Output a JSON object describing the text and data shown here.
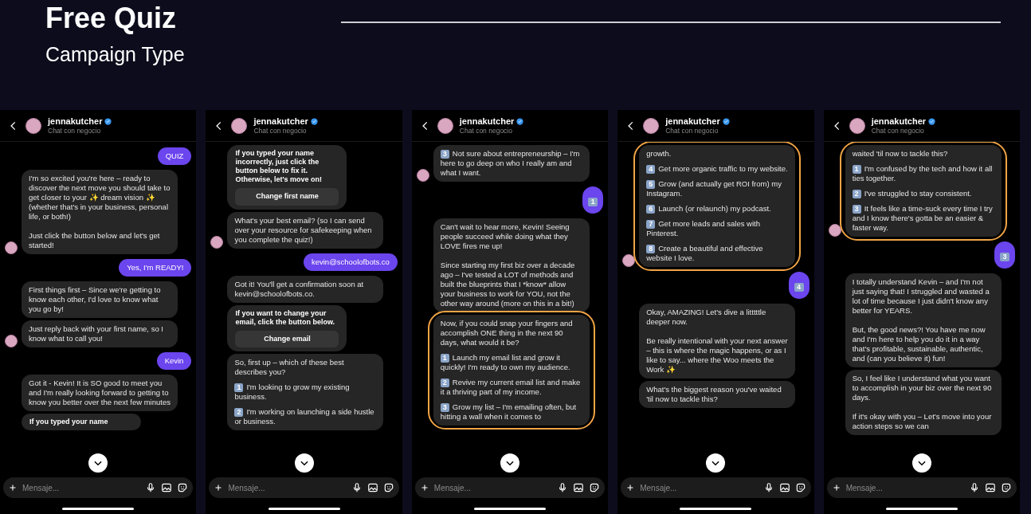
{
  "slide": {
    "title": "Free Quiz",
    "subtitle": "Campaign Type"
  },
  "phones": [
    {
      "header": {
        "name": "jennakutcher",
        "subtitle": "Chat con negocio"
      },
      "composer": {
        "placeholder": "Mensaje..."
      },
      "messages": [
        {
          "kind": "sent",
          "text": "QUIZ"
        },
        {
          "kind": "received",
          "avatar": true,
          "circled": false,
          "text": "I'm so excited you're here – ready to discover the next move you should take to get closer to your ✨ dream vision ✨ (whether that's in your business, personal life, or both!)\n\nJust click the button below and let's get started!"
        },
        {
          "kind": "sent",
          "text": "Yes, I'm READY!"
        },
        {
          "kind": "received",
          "avatar": false,
          "circled": false,
          "text": "First things first – Since we're getting to know each other, I'd love to know what you go by!"
        },
        {
          "kind": "received",
          "avatar": true,
          "circled": false,
          "text": "Just reply back with your first name, so I know what to call you!"
        },
        {
          "kind": "sent",
          "text": "Kevin"
        },
        {
          "kind": "received",
          "avatar": false,
          "circled": false,
          "text": "Got it - Kevin! It is SO good to meet you and I'm really looking forward to getting to know you better over the next few minutes"
        },
        {
          "kind": "card",
          "text": "If you typed your name"
        }
      ]
    },
    {
      "header": {
        "name": "jennakutcher",
        "subtitle": "Chat con negocio"
      },
      "composer": {
        "placeholder": "Mensaje..."
      },
      "messages": [
        {
          "kind": "card",
          "text": "If you typed your name incorrectly, just click the button below to fix it. Otherwise, let's move on!",
          "button": "Change first name"
        },
        {
          "kind": "received",
          "avatar": true,
          "circled": false,
          "text": "What's your best email? (so I can send over your resource for safekeeping when you complete the quiz!)"
        },
        {
          "kind": "sent",
          "text": "kevin@schoolofbots.co"
        },
        {
          "kind": "received",
          "avatar": false,
          "circled": false,
          "text": "Got it! You'll get a confirmation soon at kevin@schoolofbots.co."
        },
        {
          "kind": "card",
          "text": "If you want to change your email, click the button below.",
          "button": "Change email"
        },
        {
          "kind": "options",
          "avatar": false,
          "circled": false,
          "intro": "So, first up – which of these best describes you?",
          "options": [
            {
              "num": "1",
              "text": "I'm looking to grow my existing business."
            },
            {
              "num": "2",
              "text": "I'm working on launching a side hustle or business."
            }
          ]
        }
      ]
    },
    {
      "header": {
        "name": "jennakutcher",
        "subtitle": "Chat con negocio"
      },
      "composer": {
        "placeholder": "Mensaje..."
      },
      "messages": [
        {
          "kind": "options",
          "avatar": true,
          "circled": false,
          "options": [
            {
              "num": "3",
              "text": "Not sure about entrepreneurship – I'm here to go deep on who I really am and what I want."
            }
          ]
        },
        {
          "kind": "keycap",
          "num": "1"
        },
        {
          "kind": "received",
          "avatar": false,
          "circled": false,
          "text": "Can't wait to hear more, Kevin! Seeing people succeed while doing what they LOVE fires me up!\n\nSince starting my first biz over a decade ago – I've tested a LOT of methods and built the blueprints that I *know* allow your business to work for YOU, not the other way around (more on this in a bit!)"
        },
        {
          "kind": "options",
          "avatar": false,
          "circled": true,
          "intro": "Now, if you could snap your fingers and accomplish ONE thing in the next 90 days, what would it be?",
          "options": [
            {
              "num": "1",
              "text": "Launch my email list and grow it quickly! I'm ready to own my audience."
            },
            {
              "num": "2",
              "text": "Revive my current email list and make it a thriving part of my income."
            },
            {
              "num": "3",
              "text": "Grow my list – I'm emailing often, but hitting a wall when it comes to"
            }
          ]
        }
      ]
    },
    {
      "header": {
        "name": "jennakutcher",
        "subtitle": "Chat con negocio"
      },
      "composer": {
        "placeholder": "Mensaje..."
      },
      "messages": [
        {
          "kind": "options",
          "avatar": true,
          "circled": true,
          "intro": "growth.",
          "options": [
            {
              "num": "4",
              "text": "Get more organic traffic to my website."
            },
            {
              "num": "5",
              "text": "Grow (and actually get ROI from) my Instagram."
            },
            {
              "num": "6",
              "text": "Launch (or relaunch) my podcast."
            },
            {
              "num": "7",
              "text": "Get more leads and sales with Pinterest."
            },
            {
              "num": "8",
              "text": "Create a beautiful and effective website I love."
            }
          ]
        },
        {
          "kind": "keycap",
          "num": "4"
        },
        {
          "kind": "received",
          "avatar": false,
          "circled": false,
          "text": "Okay, AMAZING! Let's dive a litttttle deeper now.\n\nBe really intentional with your next answer – this is where the magic happens, or as I like to say... where the Woo meets the Work ✨"
        },
        {
          "kind": "received",
          "avatar": false,
          "circled": false,
          "text": "What's the biggest reason you've waited 'til now to tackle this?"
        }
      ]
    },
    {
      "header": {
        "name": "jennakutcher",
        "subtitle": "Chat con negocio"
      },
      "composer": {
        "placeholder": "Mensaje..."
      },
      "messages": [
        {
          "kind": "options",
          "avatar": true,
          "circled": true,
          "intro": "waited 'til now to tackle this?",
          "options": [
            {
              "num": "1",
              "text": "I'm confused by the tech and how it all ties together."
            },
            {
              "num": "2",
              "text": "I've struggled to stay consistent."
            },
            {
              "num": "3",
              "text": "It feels like a time-suck every time I try and I know there's gotta be an easier & faster way."
            }
          ]
        },
        {
          "kind": "keycap",
          "num": "3"
        },
        {
          "kind": "received",
          "avatar": false,
          "circled": false,
          "text": "I totally understand Kevin – and I'm not just saying that! I struggled and wasted a lot of time because I just didn't know any better for YEARS.\n\nBut, the good news?! You have me now and I'm here to help you do it in a way that's profitable, sustainable, authentic, and (can you believe it) fun!"
        },
        {
          "kind": "received",
          "avatar": false,
          "circled": false,
          "text": "So, I feel like I understand what you want to accomplish in your biz over the next 90 days.\n\nIf it's okay with you – Let's move into your action steps so we can"
        }
      ]
    }
  ]
}
